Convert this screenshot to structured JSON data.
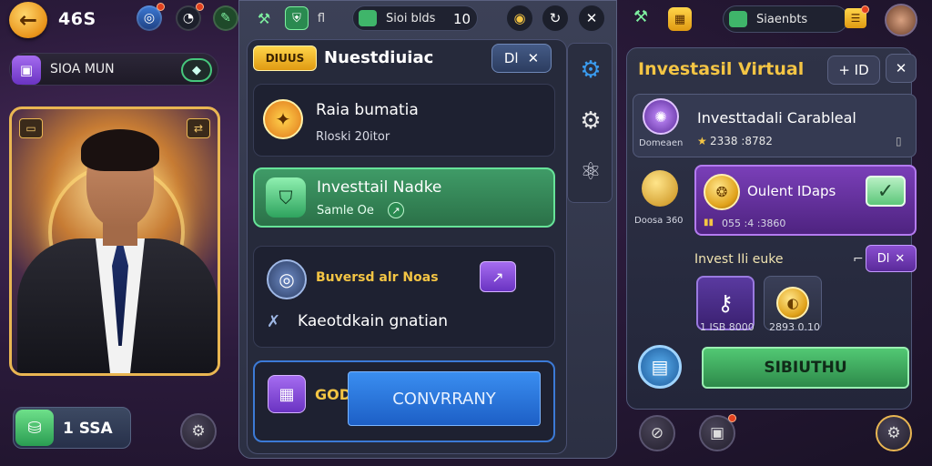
{
  "left": {
    "score": "46S",
    "name_label": "SIOA MUN",
    "cash_value": "1 SSA",
    "icons": [
      "back-arrow-icon",
      "globe-icon",
      "clock-icon",
      "leaf-icon",
      "wallet-icon",
      "toggle-icon",
      "card-icon",
      "swap-icon",
      "gear-icon"
    ]
  },
  "mid": {
    "top_chip": "fl",
    "coins_label": "Sioi blds",
    "coins_value": "10",
    "tag": "DIUUS",
    "title": "Nuestdiuiac",
    "close_prefix": "Dl",
    "cards": [
      {
        "title": "Raia bumatia",
        "subtitle": "Rloski 20itor"
      },
      {
        "title": "Investtail Nadke",
        "subtitle": "Samle Oe"
      },
      {
        "title": "Buversd alr Noas",
        "line2": "Kaeotdkain gnatian"
      },
      {
        "badge": "GOD",
        "button": "CONVRRANY"
      }
    ]
  },
  "right": {
    "coins_label": "Siaenbts",
    "title": "Investasil Virtual",
    "header_btn": "+ ID",
    "card1": {
      "title": "Investtadali Carableal",
      "sub_name": "Domeaen",
      "sub_value": "2338 :8782"
    },
    "coins_left_label": "Doosa 360",
    "card2": {
      "title": "Oulent IDaps",
      "value": "055 :4 :3860"
    },
    "invest_label": "Invest IIi euke",
    "invest_tag": "Dl",
    "items": [
      {
        "value": "1 ISB 8000"
      },
      {
        "value": "2893 0.10"
      }
    ],
    "action_button": "SIBIUTHU"
  },
  "colors": {
    "accent_gold": "#f4c544",
    "accent_green": "#52c874",
    "accent_purple": "#7a3fb8",
    "accent_blue": "#3a8ef0"
  }
}
